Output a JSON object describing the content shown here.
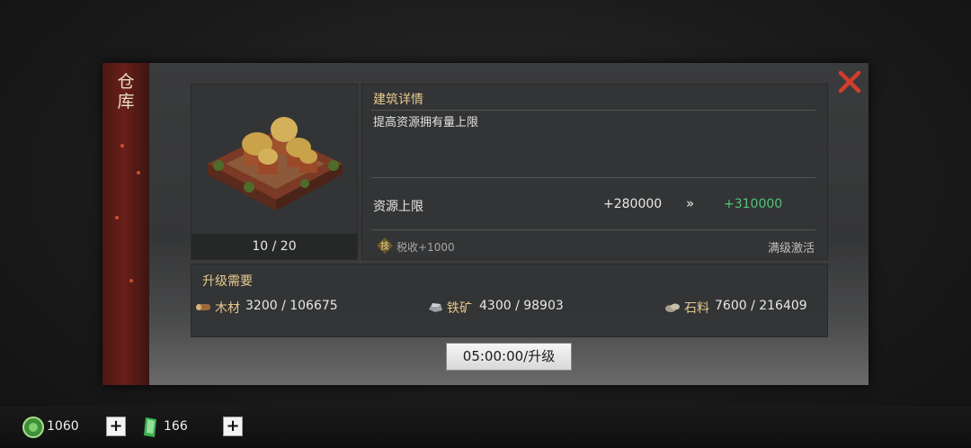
{
  "sidebar": {
    "title": "仓库"
  },
  "building": {
    "level_text": "10 / 20"
  },
  "details": {
    "title": "建筑详情",
    "description": "提高资源拥有量上限",
    "stat_label": "资源上限",
    "stat_current": "+280000",
    "stat_arrow": "»",
    "stat_next": "+310000",
    "tech_badge": "技",
    "tech_bonus": "税收+1000",
    "max_level_note": "满级激活"
  },
  "requirements": {
    "title": "升级需要",
    "items": [
      {
        "name": "木材",
        "value": "3200 / 106675",
        "icon": "wood-log-icon"
      },
      {
        "name": "铁矿",
        "value": "4300 / 98903",
        "icon": "iron-ore-icon"
      },
      {
        "name": "石料",
        "value": "7600 / 216409",
        "icon": "stone-icon"
      }
    ]
  },
  "upgrade_button": {
    "label": "05:00:00/升级"
  },
  "resources": [
    {
      "value": "1060",
      "icon": "jade-coin-icon"
    },
    {
      "value": "166",
      "icon": "green-token-icon"
    }
  ],
  "colors": {
    "accent_gold": "#e6c98d",
    "increase_green": "#52c27a",
    "close_red": "#d23c2d",
    "banner_red": "#6a1f18"
  }
}
